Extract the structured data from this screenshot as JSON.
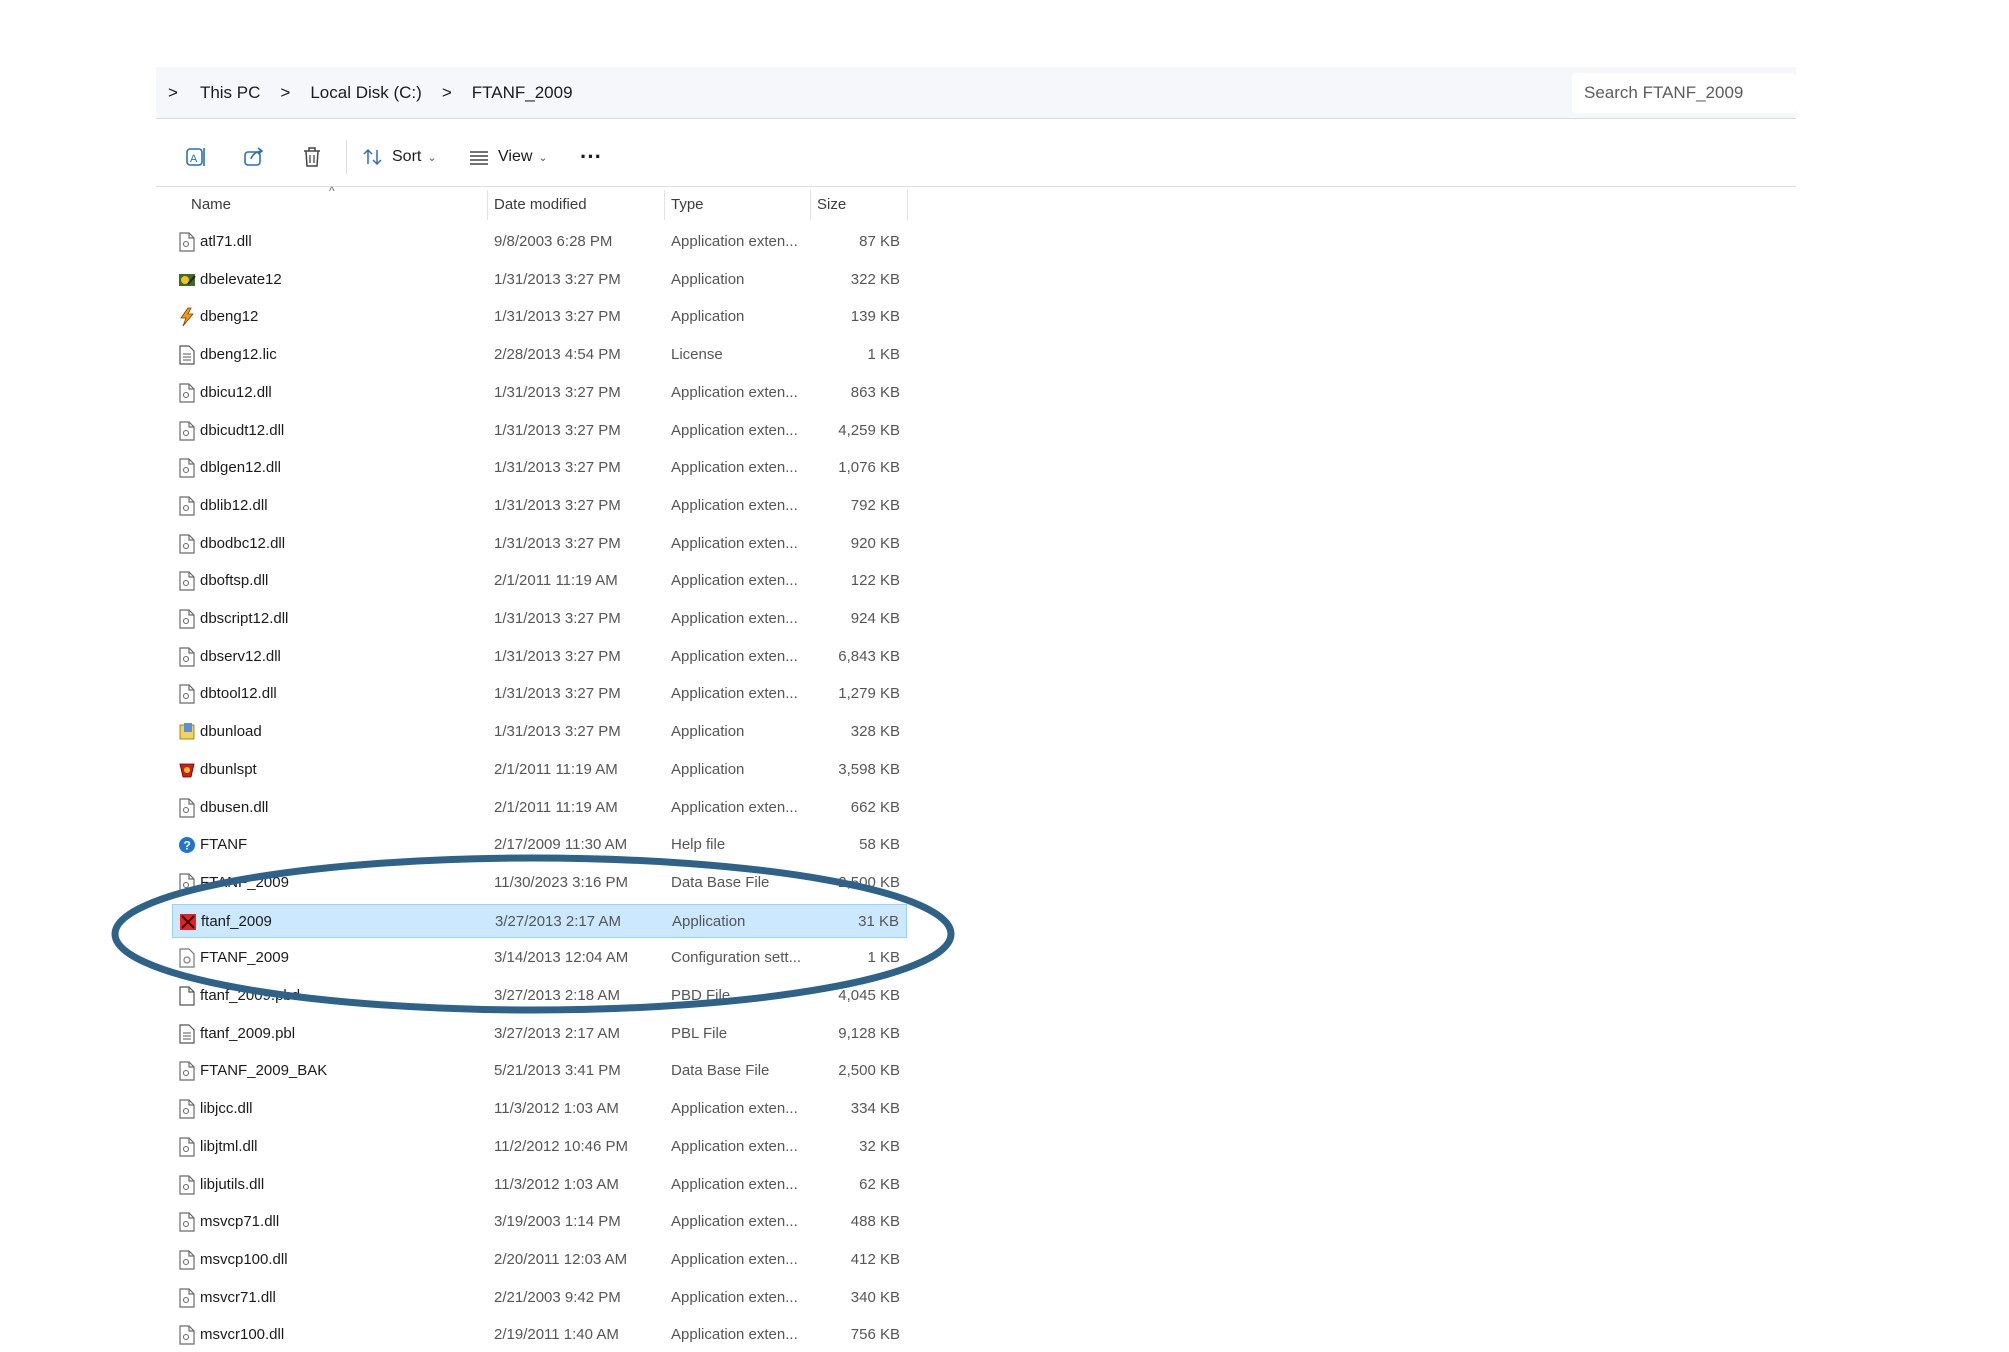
{
  "breadcrumb": {
    "root_chevron": ">",
    "items": [
      "This PC",
      "Local Disk (C:)",
      "FTANF_2009"
    ],
    "separator": ">"
  },
  "search": {
    "placeholder": "Search FTANF_2009"
  },
  "toolbar": {
    "rename_icon": "rename-icon",
    "share_icon": "share-icon",
    "delete_icon": "trash-icon",
    "sort_label": "Sort",
    "view_label": "View",
    "more_label": "···"
  },
  "columns": {
    "name": "Name",
    "date": "Date modified",
    "type": "Type",
    "size": "Size",
    "sort_indicator": "^"
  },
  "files": [
    {
      "name": "atl71.dll",
      "date": "9/8/2003 6:28 PM",
      "type": "Application exten...",
      "size": "87 KB",
      "icon": "dll"
    },
    {
      "name": "dbelevate12",
      "date": "1/31/2013 3:27 PM",
      "type": "Application",
      "size": "322 KB",
      "icon": "app-gear"
    },
    {
      "name": "dbeng12",
      "date": "1/31/2013 3:27 PM",
      "type": "Application",
      "size": "139 KB",
      "icon": "app-bolt"
    },
    {
      "name": "dbeng12.lic",
      "date": "2/28/2013 4:54 PM",
      "type": "License",
      "size": "1 KB",
      "icon": "text"
    },
    {
      "name": "dbicu12.dll",
      "date": "1/31/2013 3:27 PM",
      "type": "Application exten...",
      "size": "863 KB",
      "icon": "dll"
    },
    {
      "name": "dbicudt12.dll",
      "date": "1/31/2013 3:27 PM",
      "type": "Application exten...",
      "size": "4,259 KB",
      "icon": "dll"
    },
    {
      "name": "dblgen12.dll",
      "date": "1/31/2013 3:27 PM",
      "type": "Application exten...",
      "size": "1,076 KB",
      "icon": "dll"
    },
    {
      "name": "dblib12.dll",
      "date": "1/31/2013 3:27 PM",
      "type": "Application exten...",
      "size": "792 KB",
      "icon": "dll"
    },
    {
      "name": "dbodbc12.dll",
      "date": "1/31/2013 3:27 PM",
      "type": "Application exten...",
      "size": "920 KB",
      "icon": "dll"
    },
    {
      "name": "dboftsp.dll",
      "date": "2/1/2011 11:19 AM",
      "type": "Application exten...",
      "size": "122 KB",
      "icon": "dll"
    },
    {
      "name": "dbscript12.dll",
      "date": "1/31/2013 3:27 PM",
      "type": "Application exten...",
      "size": "924 KB",
      "icon": "dll"
    },
    {
      "name": "dbserv12.dll",
      "date": "1/31/2013 3:27 PM",
      "type": "Application exten...",
      "size": "6,843 KB",
      "icon": "dll"
    },
    {
      "name": "dbtool12.dll",
      "date": "1/31/2013 3:27 PM",
      "type": "Application exten...",
      "size": "1,279 KB",
      "icon": "dll"
    },
    {
      "name": "dbunload",
      "date": "1/31/2013 3:27 PM",
      "type": "Application",
      "size": "328 KB",
      "icon": "app-unload"
    },
    {
      "name": "dbunlspt",
      "date": "2/1/2011 11:19 AM",
      "type": "Application",
      "size": "3,598 KB",
      "icon": "app-red"
    },
    {
      "name": "dbusen.dll",
      "date": "2/1/2011 11:19 AM",
      "type": "Application exten...",
      "size": "662 KB",
      "icon": "dll"
    },
    {
      "name": "FTANF",
      "date": "2/17/2009 11:30 AM",
      "type": "Help file",
      "size": "58 KB",
      "icon": "help"
    },
    {
      "name": "FTANF_2009",
      "date": "11/30/2023 3:16 PM",
      "type": "Data Base File",
      "size": "2,500 KB",
      "icon": "dll"
    },
    {
      "name": "ftanf_2009",
      "date": "3/27/2013 2:17 AM",
      "type": "Application",
      "size": "31 KB",
      "icon": "app-ftanf",
      "selected": true
    },
    {
      "name": "FTANF_2009",
      "date": "3/14/2013 12:04 AM",
      "type": "Configuration sett...",
      "size": "1 KB",
      "icon": "config"
    },
    {
      "name": "ftanf_2009.pbd",
      "date": "3/27/2013 2:18 AM",
      "type": "PBD File",
      "size": "4,045 KB",
      "icon": "blank"
    },
    {
      "name": "ftanf_2009.pbl",
      "date": "3/27/2013 2:17 AM",
      "type": "PBL File",
      "size": "9,128 KB",
      "icon": "text"
    },
    {
      "name": "FTANF_2009_BAK",
      "date": "5/21/2013 3:41 PM",
      "type": "Data Base File",
      "size": "2,500 KB",
      "icon": "dll"
    },
    {
      "name": "libjcc.dll",
      "date": "11/3/2012 1:03 AM",
      "type": "Application exten...",
      "size": "334 KB",
      "icon": "dll"
    },
    {
      "name": "libjtml.dll",
      "date": "11/2/2012 10:46 PM",
      "type": "Application exten...",
      "size": "32 KB",
      "icon": "dll"
    },
    {
      "name": "libjutils.dll",
      "date": "11/3/2012 1:03 AM",
      "type": "Application exten...",
      "size": "62 KB",
      "icon": "dll"
    },
    {
      "name": "msvcp71.dll",
      "date": "3/19/2003 1:14 PM",
      "type": "Application exten...",
      "size": "488 KB",
      "icon": "dll"
    },
    {
      "name": "msvcp100.dll",
      "date": "2/20/2011 12:03 AM",
      "type": "Application exten...",
      "size": "412 KB",
      "icon": "dll"
    },
    {
      "name": "msvcr71.dll",
      "date": "2/21/2003 9:42 PM",
      "type": "Application exten...",
      "size": "340 KB",
      "icon": "dll"
    },
    {
      "name": "msvcr100.dll",
      "date": "2/19/2011 1:40 AM",
      "type": "Application exten...",
      "size": "756 KB",
      "icon": "dll"
    }
  ],
  "annotation": {
    "shape": "ellipse",
    "color": "#2e6289"
  }
}
